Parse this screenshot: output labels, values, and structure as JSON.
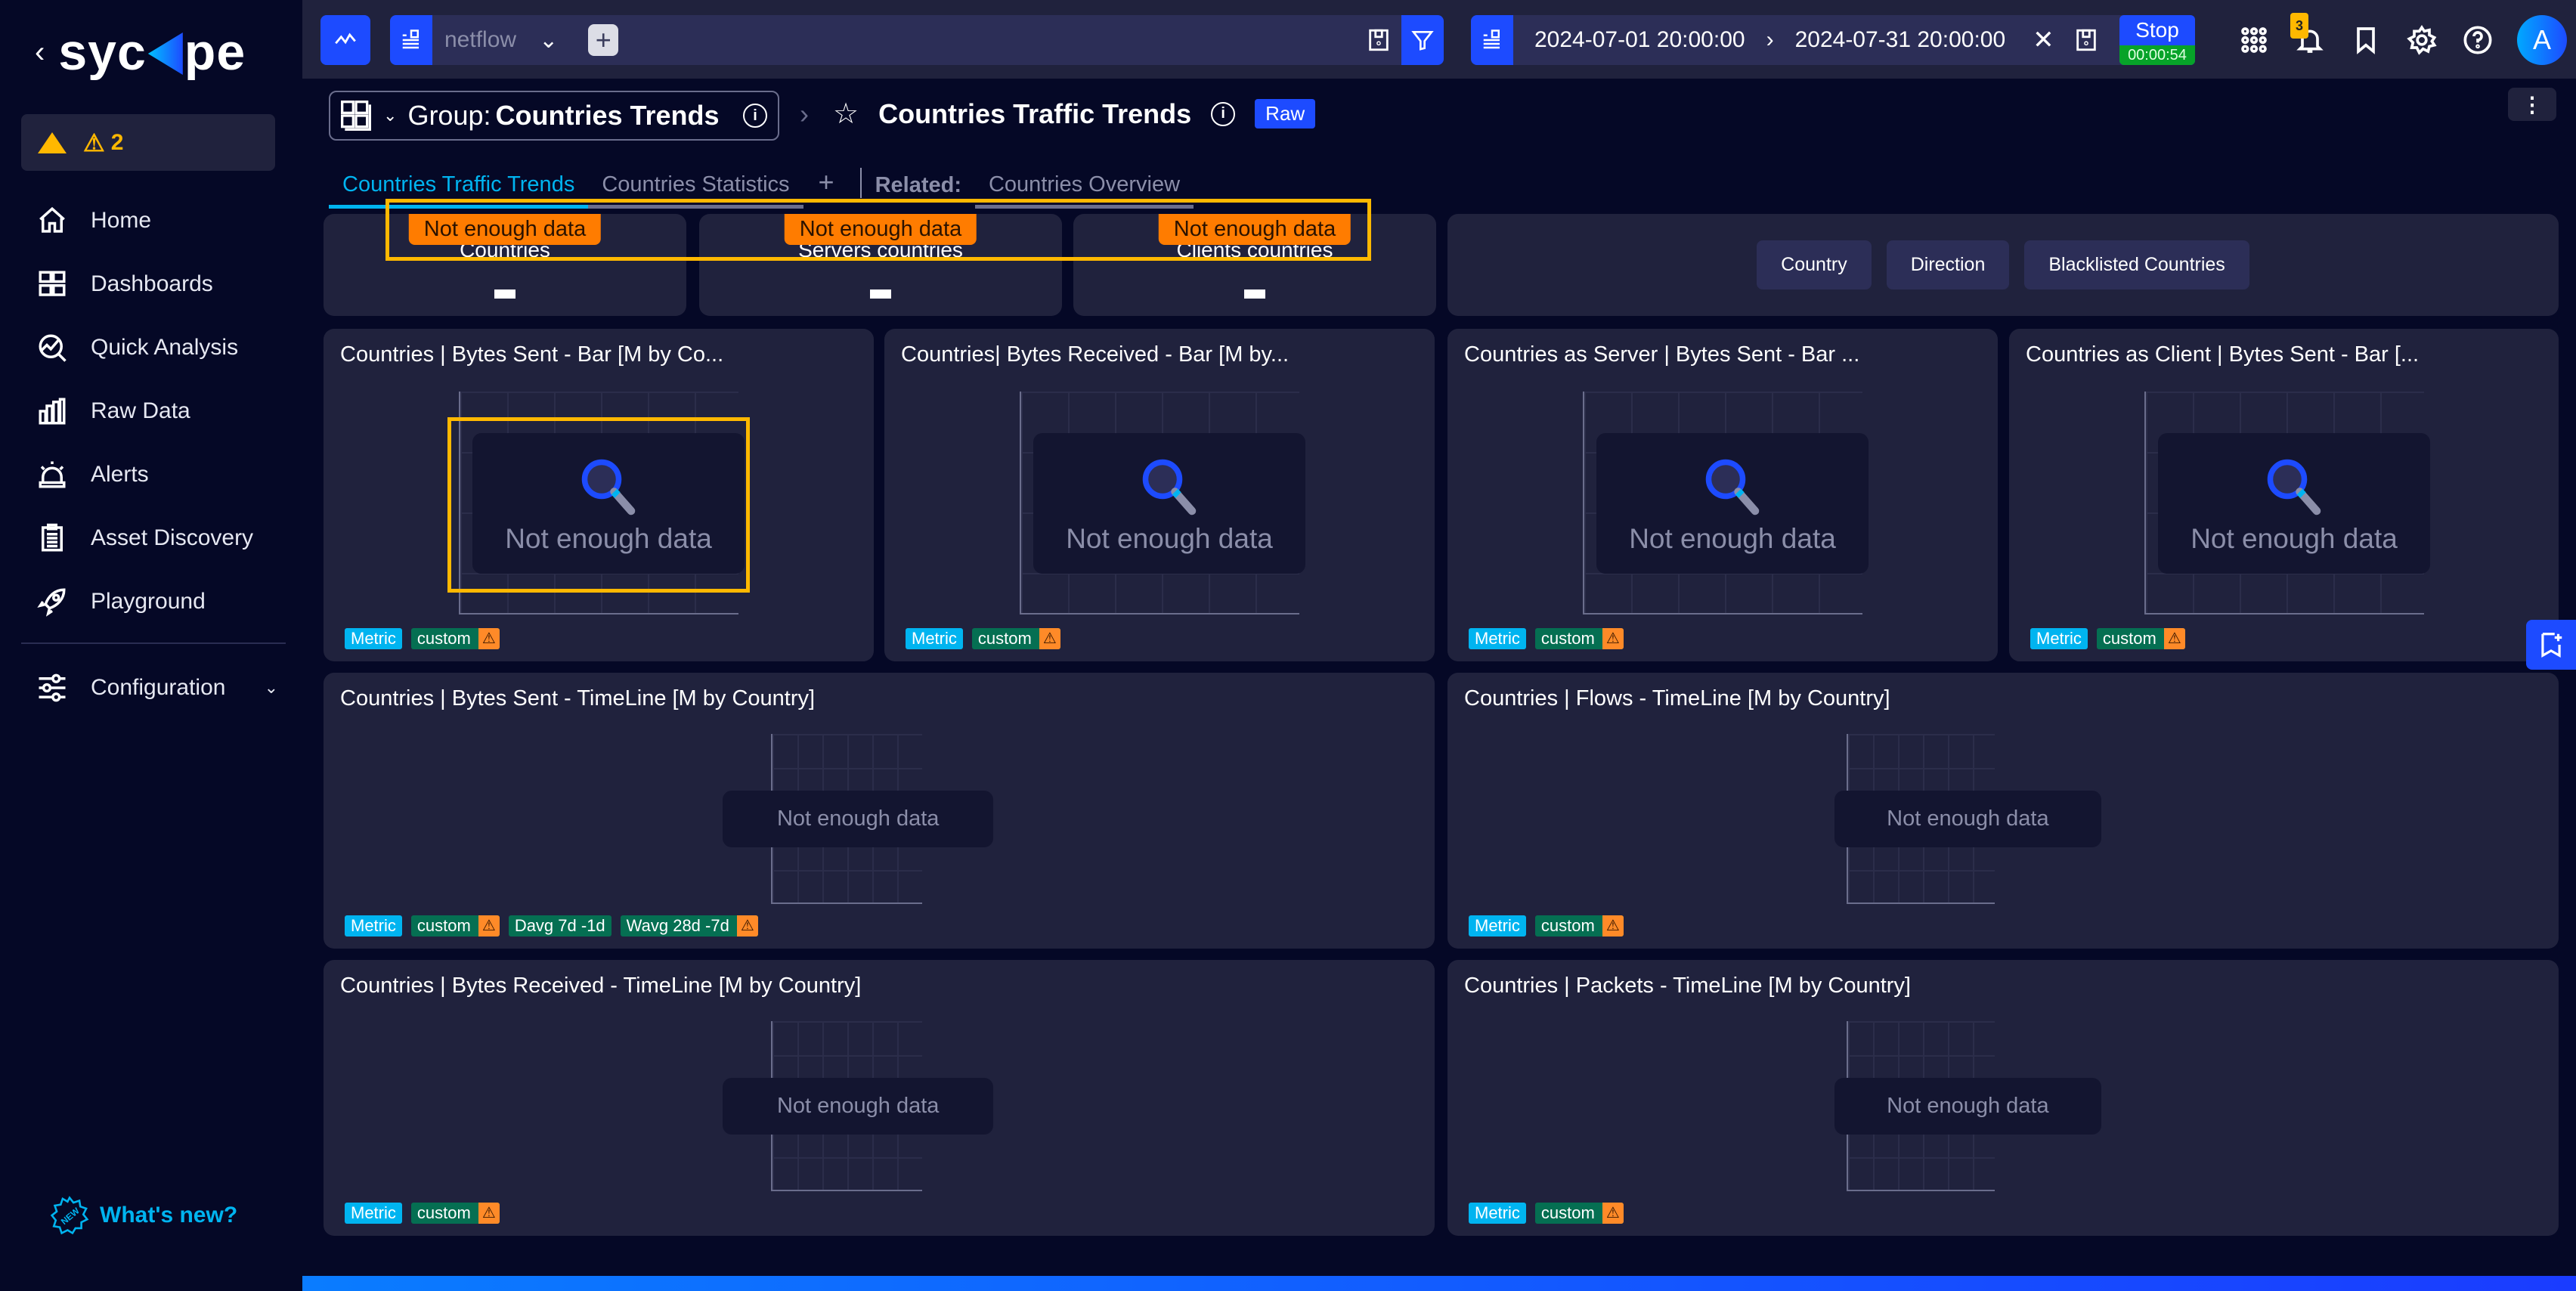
{
  "sidebar": {
    "brand": "sycope",
    "collapse_icon": "chevron-left-icon",
    "alert_count": "2",
    "items": [
      {
        "label": "Home",
        "icon": "home-icon"
      },
      {
        "label": "Dashboards",
        "icon": "dashboards-icon"
      },
      {
        "label": "Quick Analysis",
        "icon": "quick-analysis-icon"
      },
      {
        "label": "Raw Data",
        "icon": "bar-chart-icon"
      },
      {
        "label": "Alerts",
        "icon": "siren-icon"
      },
      {
        "label": "Asset Discovery",
        "icon": "clipboard-icon"
      },
      {
        "label": "Playground",
        "icon": "rocket-icon"
      }
    ],
    "config_label": "Configuration",
    "whats_new": "What's new?",
    "whats_new_badge": "NEW"
  },
  "topbar": {
    "source": "netflow",
    "time_from": "2024-07-01 20:00:00",
    "time_to": "2024-07-31 20:00:00",
    "stop_label": "Stop",
    "stop_timer": "00:00:54",
    "notifications_count": "3",
    "avatar_initial": "A"
  },
  "header": {
    "group_prefix": "Group:",
    "group_name": "Countries Trends",
    "dashboard_title": "Countries Traffic Trends",
    "mode_badge": "Raw"
  },
  "tabs": {
    "items": [
      "Countries Traffic Trends",
      "Countries Statistics"
    ],
    "add": "+",
    "related_label": "Related:",
    "related_items": [
      "Countries Overview"
    ]
  },
  "kpis": [
    {
      "label": "Countries",
      "value": "–",
      "status": "Not enough data"
    },
    {
      "label": "Servers countries",
      "value": "–",
      "status": "Not enough data"
    },
    {
      "label": "Clients countries",
      "value": "–",
      "status": "Not enough data"
    }
  ],
  "filters": [
    "Country",
    "Direction",
    "Blacklisted Countries"
  ],
  "widgets": {
    "bars": [
      {
        "title": "Countries | Bytes Sent - Bar [M by Co...",
        "message": "Not enough data",
        "tags": [
          "Metric",
          "custom"
        ]
      },
      {
        "title": "Countries| Bytes Received - Bar [M by...",
        "message": "Not enough data",
        "tags": [
          "Metric",
          "custom"
        ]
      },
      {
        "title": "Countries as Server | Bytes Sent - Bar ...",
        "message": "Not enough data",
        "tags": [
          "Metric",
          "custom"
        ]
      },
      {
        "title": "Countries as Client | Bytes Sent - Bar [...",
        "message": "Not enough data",
        "tags": [
          "Metric",
          "custom"
        ]
      }
    ],
    "timelines": [
      {
        "title": "Countries | Bytes Sent - TimeLine [M by Country]",
        "message": "Not enough data",
        "tags": [
          "Metric",
          "custom",
          "Davg 7d -1d",
          "Wavg 28d -7d"
        ]
      },
      {
        "title": "Countries | Flows - TimeLine [M by Country]",
        "message": "Not enough data",
        "tags": [
          "Metric",
          "custom"
        ]
      },
      {
        "title": "Countries | Bytes Received - TimeLine [M by Country]",
        "message": "Not enough data",
        "tags": [
          "Metric",
          "custom"
        ]
      },
      {
        "title": "Countries | Packets - TimeLine [M by Country]",
        "message": "Not enough data",
        "tags": [
          "Metric",
          "custom"
        ]
      }
    ]
  },
  "colors": {
    "accent": "#1d4bff",
    "cyan": "#00b4f0",
    "warning": "#ffb800",
    "nodata_orange": "#ff7c00",
    "tag_green": "#056f52",
    "stop_green": "#07a329"
  }
}
